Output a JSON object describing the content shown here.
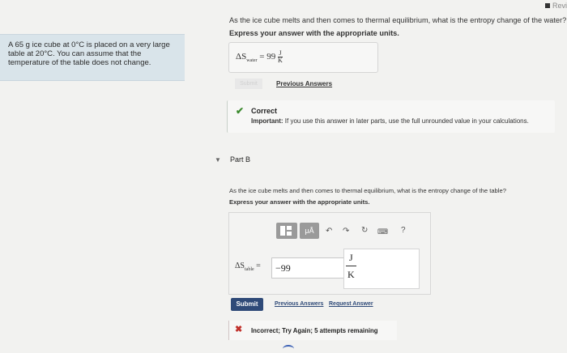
{
  "header": {
    "review_label": "Revi"
  },
  "problem": {
    "line1": "A 65 g ice cube at 0°C is placed on a very large",
    "line2": "table at 20°C. You can assume that the",
    "line3": "temperature of the table does not change."
  },
  "part_a": {
    "question": "As the ice cube melts and then comes to thermal equilibrium, what is the entropy change of the water?",
    "instruction": "Express your answer with the appropriate units.",
    "answer_label": "ΔS",
    "answer_sub": "water",
    "answer_eq": "=",
    "answer_value": "99",
    "unit_num": "J",
    "unit_den": "K",
    "submit_label": "Submit",
    "previous_answers": "Previous Answers",
    "feedback": {
      "title": "Correct",
      "important_label": "Important:",
      "important_text": "If you use this answer in later parts, use the full unrounded value in your calculations."
    }
  },
  "part_b": {
    "label": "Part B",
    "question": "As the ice cube melts and then comes to thermal equilibrium, what is the entropy change of the table?",
    "instruction": "Express your answer with the appropriate units.",
    "toolbar": {
      "templates_icon": "templates-icon",
      "units_label": "μÅ",
      "undo_icon": "undo-icon",
      "redo_icon": "redo-icon",
      "reset_icon": "reset-icon",
      "keyboard_icon": "keyboard-icon",
      "help_label": "?"
    },
    "answer_label": "ΔS",
    "answer_sub": "table",
    "answer_eq": "=",
    "answer_value": "−99",
    "unit_num": "J",
    "unit_den": "K",
    "submit_label": "Submit",
    "previous_answers": "Previous Answers",
    "request_answer": "Request Answer",
    "feedback": {
      "text": "Incorrect; Try Again; 5 attempts remaining"
    }
  },
  "colors": {
    "left_panel": "#d9e4ea",
    "submit": "#2f4a78",
    "correct": "#3b8a2e",
    "incorrect": "#c0302b"
  }
}
